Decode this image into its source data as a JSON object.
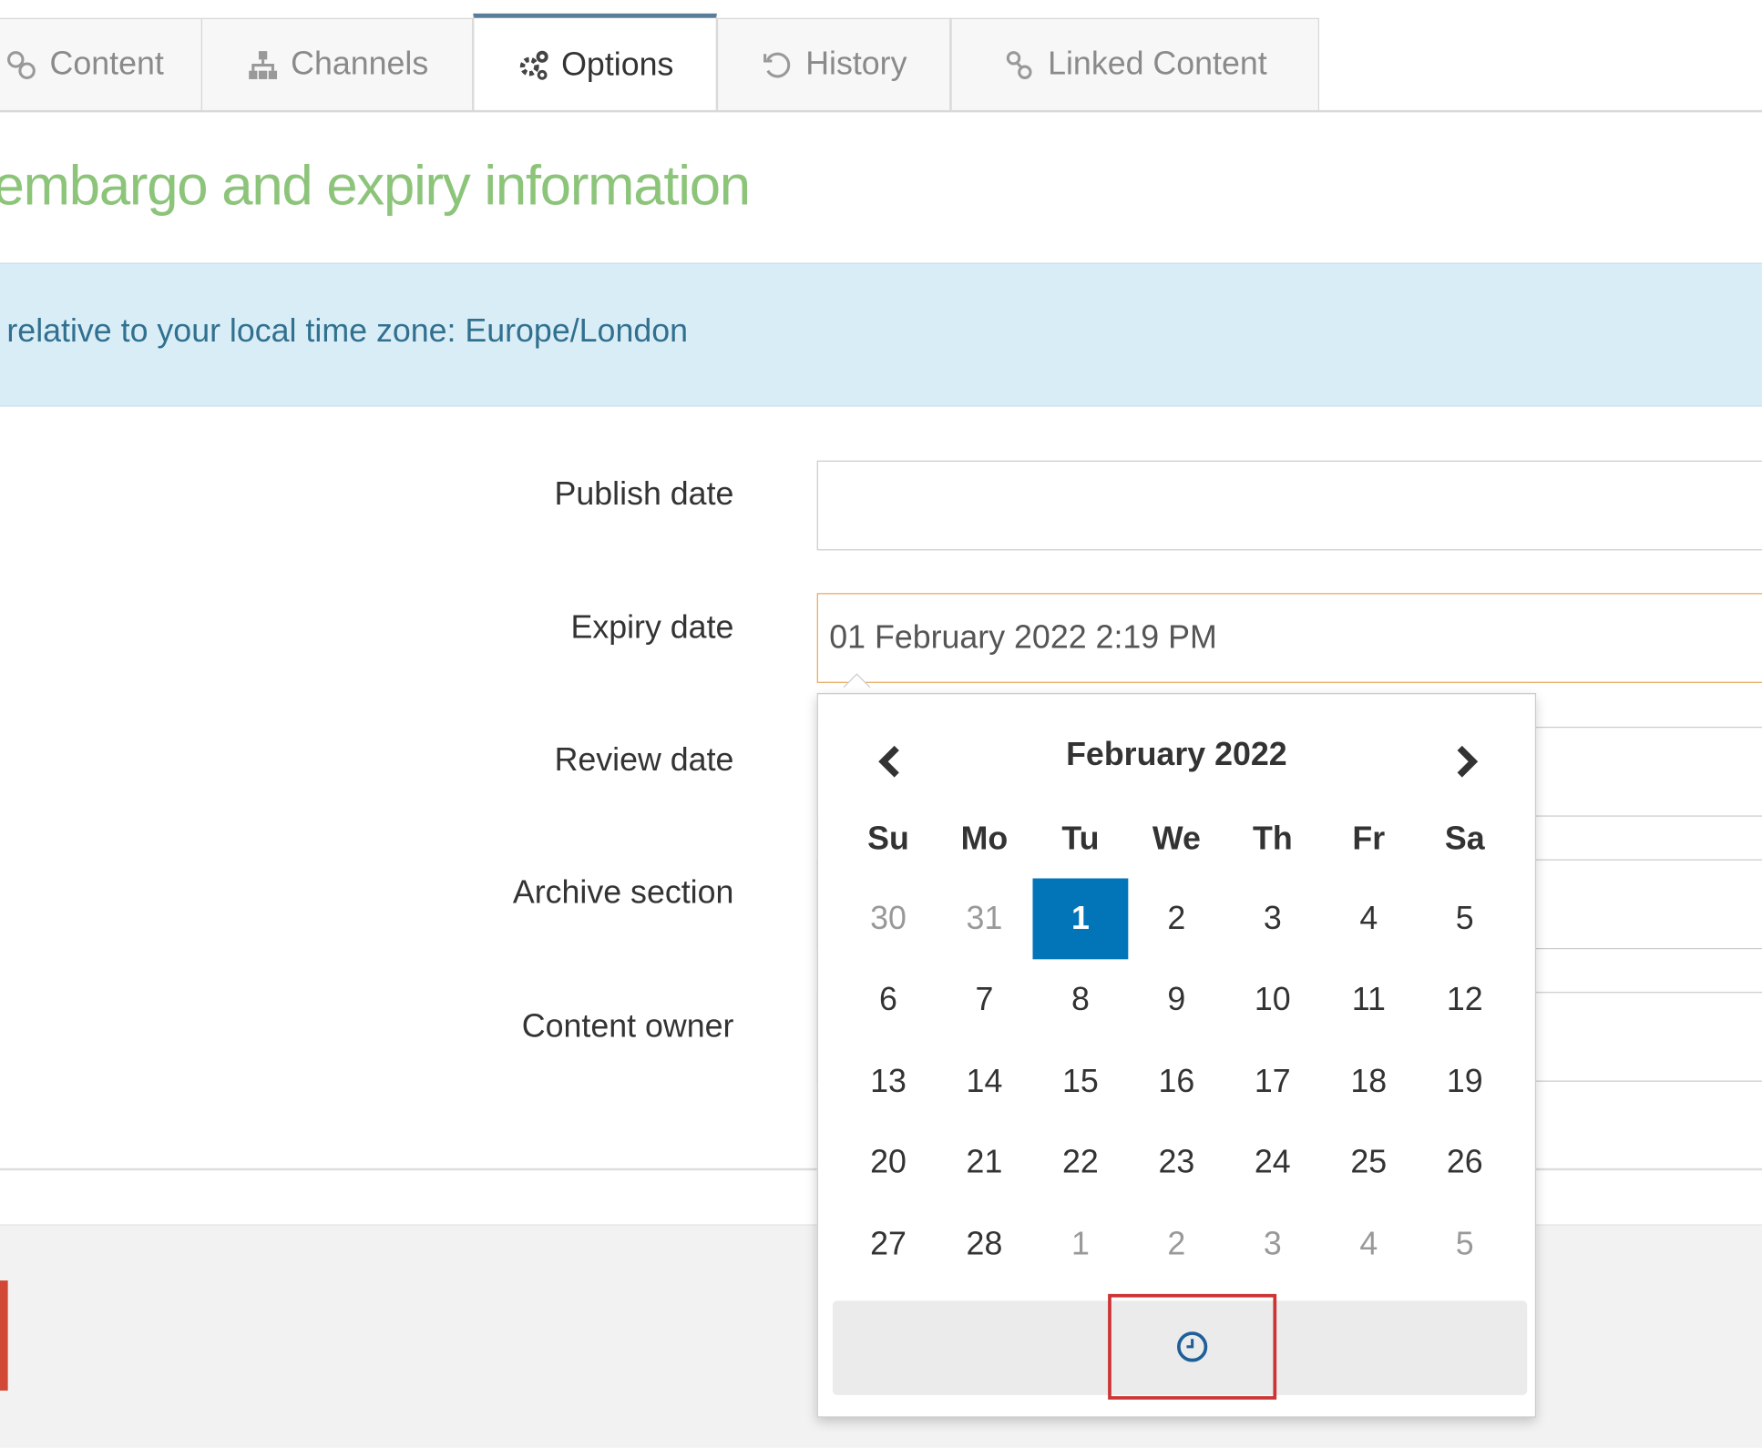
{
  "tabs": [
    {
      "label": "Content",
      "icon": "content-icon",
      "active": false
    },
    {
      "label": "Channels",
      "icon": "sitemap-icon",
      "active": false
    },
    {
      "label": "Options",
      "icon": "gears-icon",
      "active": true
    },
    {
      "label": "History",
      "icon": "history-icon",
      "active": false
    },
    {
      "label": "Linked Content",
      "icon": "link-icon",
      "active": false
    }
  ],
  "heading": "embargo and expiry information",
  "info": "relative to your local time zone: Europe/London",
  "form": {
    "publish_label": "Publish date",
    "publish_value": "",
    "expiry_label": "Expiry date",
    "expiry_value": "01 February 2022 2:19 PM",
    "review_label": "Review date",
    "archive_label": "Archive section",
    "owner_label": "Content owner"
  },
  "datepicker": {
    "title": "February 2022",
    "weekdays": [
      "Su",
      "Mo",
      "Tu",
      "We",
      "Th",
      "Fr",
      "Sa"
    ],
    "weeks": [
      [
        "30",
        "31",
        "1",
        "2",
        "3",
        "4",
        "5"
      ],
      [
        "6",
        "7",
        "8",
        "9",
        "10",
        "11",
        "12"
      ],
      [
        "13",
        "14",
        "15",
        "16",
        "17",
        "18",
        "19"
      ],
      [
        "20",
        "21",
        "22",
        "23",
        "24",
        "25",
        "26"
      ],
      [
        "27",
        "28",
        "1",
        "2",
        "3",
        "4",
        "5"
      ]
    ],
    "selected": "1",
    "toggle_icon": "clock-icon"
  },
  "colors": {
    "accent": "#0275b8",
    "heading": "#8cc47a",
    "info_bg": "#d9edf7",
    "info_text": "#31708f",
    "highlight": "#cc3333"
  }
}
